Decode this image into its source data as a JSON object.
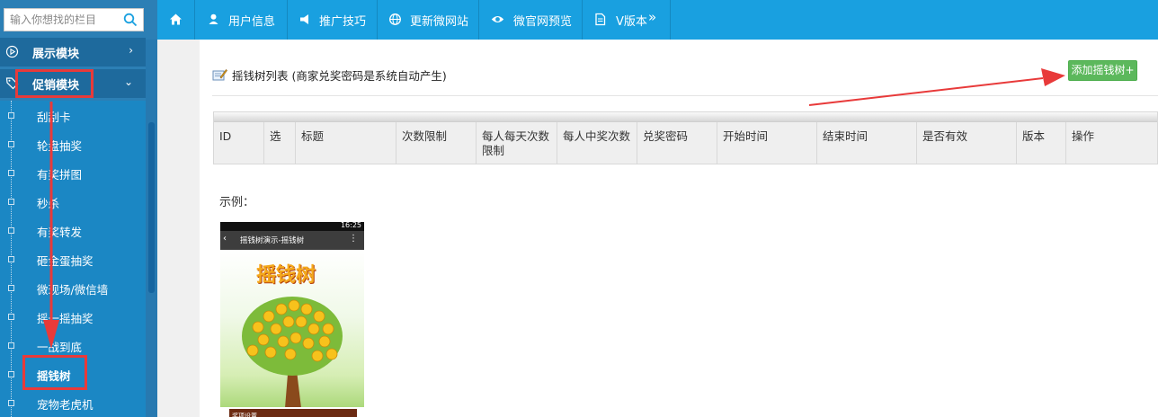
{
  "search": {
    "placeholder": "输入你想找的栏目"
  },
  "sidebar": {
    "sections": [
      {
        "label": "展示模块",
        "chevron": "›"
      },
      {
        "label": "促销模块",
        "chevron": "⌄"
      }
    ],
    "items": [
      {
        "label": "刮刮卡"
      },
      {
        "label": "轮盘抽奖"
      },
      {
        "label": "有奖拼图"
      },
      {
        "label": "秒杀"
      },
      {
        "label": "有奖转发"
      },
      {
        "label": "砸金蛋抽奖"
      },
      {
        "label": "微现场/微信墙"
      },
      {
        "label": "摇一摇抽奖"
      },
      {
        "label": "一战到底"
      },
      {
        "label": "摇钱树"
      },
      {
        "label": "宠物老虎机"
      }
    ]
  },
  "topnav": {
    "items": [
      {
        "label": "",
        "icon": "home-icon"
      },
      {
        "label": "用户信息",
        "icon": "user-icon"
      },
      {
        "label": "推广技巧",
        "icon": "megaphone-icon"
      },
      {
        "label": "更新微网站",
        "icon": "globe-icon"
      },
      {
        "label": "微官网预览",
        "icon": "eye-icon"
      },
      {
        "label": "V版本",
        "icon": "document-icon",
        "suffix": "»"
      }
    ]
  },
  "main": {
    "title": "摇钱树列表 (商家兑奖密码是系统自动产生)",
    "add_button": "添加摇钱树+",
    "table": {
      "columns": [
        "ID",
        "选",
        "标题",
        "次数限制",
        "每人每天次数限制",
        "每人中奖次数",
        "兑奖密码",
        "开始时间",
        "结束时间",
        "是否有效",
        "版本",
        "操作"
      ]
    },
    "example_label": "示例：",
    "phone": {
      "clock": "16:25",
      "titlebar": "摇钱树演示-摇钱树",
      "heading": "摇钱树",
      "footer": "奖项设置"
    }
  },
  "colors": {
    "topbar": "#19a0e0",
    "sidebar": "#2c7fb5",
    "add_button": "#5cb85c",
    "annotation_red": "#e83a3a"
  }
}
